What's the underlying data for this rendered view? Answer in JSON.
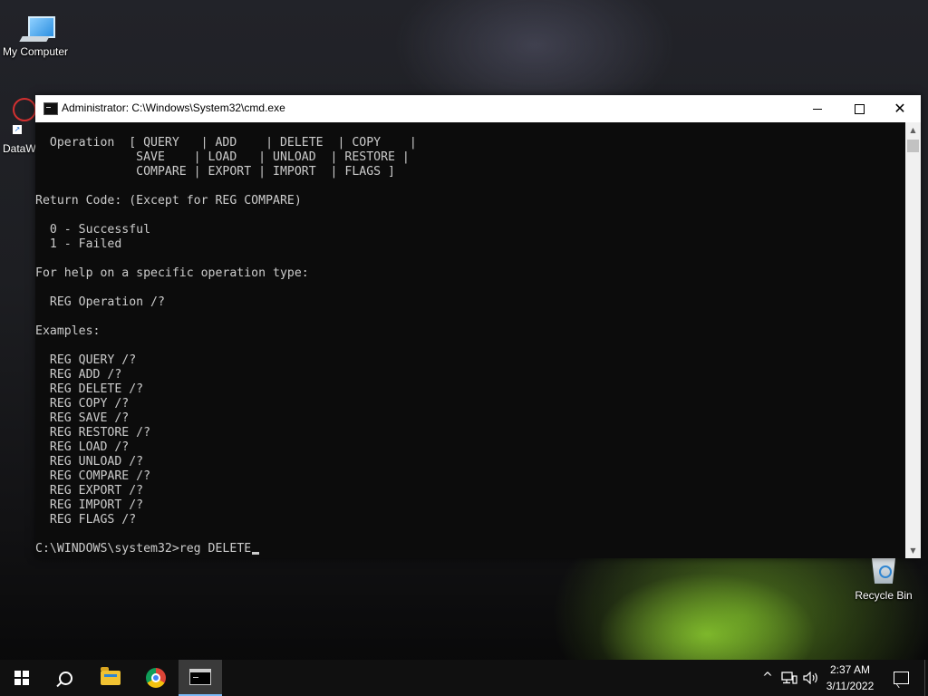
{
  "desktop": {
    "icons": [
      {
        "label": "My Computer"
      },
      {
        "label": "DataW"
      },
      {
        "label": "Recycle Bin"
      }
    ]
  },
  "window": {
    "title": "Administrator: C:\\Windows\\System32\\cmd.exe",
    "controls": {
      "minimize_icon": "minimize-icon",
      "maximize_icon": "maximize-icon",
      "close_icon": "close-icon"
    }
  },
  "console": {
    "text": "  Operation  [ QUERY   | ADD    | DELETE  | COPY    |\n              SAVE    | LOAD   | UNLOAD  | RESTORE |\n              COMPARE | EXPORT | IMPORT  | FLAGS ]\n\nReturn Code: (Except for REG COMPARE)\n\n  0 - Successful\n  1 - Failed\n\nFor help on a specific operation type:\n\n  REG Operation /?\n\nExamples:\n\n  REG QUERY /?\n  REG ADD /?\n  REG DELETE /?\n  REG COPY /?\n  REG SAVE /?\n  REG RESTORE /?\n  REG LOAD /?\n  REG UNLOAD /?\n  REG COMPARE /?\n  REG EXPORT /?\n  REG IMPORT /?\n  REG FLAGS /?",
    "prompt": "C:\\WINDOWS\\system32>",
    "command": "reg DELETE"
  },
  "taskbar": {
    "items": [
      "start-icon",
      "search-icon",
      "file-explorer-icon",
      "chrome-icon",
      "cmd-icon"
    ],
    "tray": {
      "chevron": "^",
      "time": "2:37 AM",
      "date": "3/11/2022"
    }
  },
  "colors": {
    "console_bg": "#0c0c0c",
    "console_fg": "#cccccc",
    "taskbar_bg": "#101010",
    "accent": "#7ab8f5"
  }
}
